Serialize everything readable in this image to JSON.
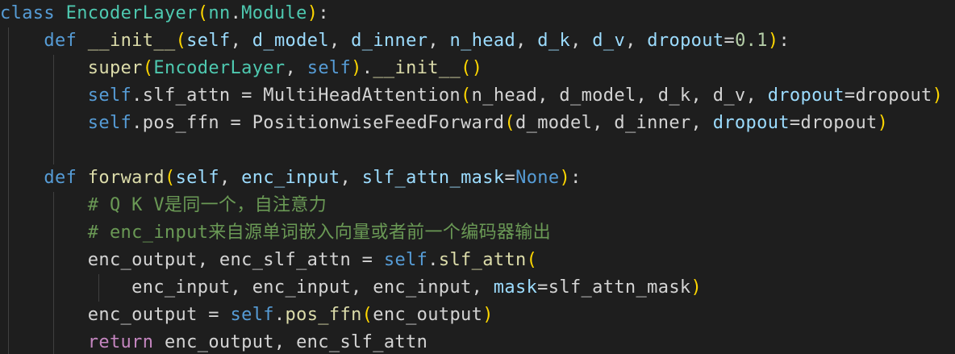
{
  "colors": {
    "background": "#1e1e1e",
    "indent_guide": "#404040",
    "kw": "#569cd6",
    "ctl": "#c586c0",
    "cls": "#4ec9b0",
    "fn": "#dcdcaa",
    "var": "#9cdcfe",
    "num": "#b5cea8",
    "cmt": "#6a9955",
    "txt": "#d4d4d4",
    "p1": "#ffd700",
    "p2": "#da70d6"
  },
  "code_lines": [
    [
      [
        "kw",
        "class"
      ],
      [
        "txt",
        " "
      ],
      [
        "cls",
        "EncoderLayer"
      ],
      [
        "p1",
        "("
      ],
      [
        "cls",
        "nn"
      ],
      [
        "txt",
        "."
      ],
      [
        "cls",
        "Module"
      ],
      [
        "p1",
        ")"
      ],
      [
        "txt",
        ":"
      ]
    ],
    [
      [
        "txt",
        "    "
      ],
      [
        "kw",
        "def"
      ],
      [
        "txt",
        " "
      ],
      [
        "fn",
        "__init__"
      ],
      [
        "p1",
        "("
      ],
      [
        "var",
        "self"
      ],
      [
        "txt",
        ", "
      ],
      [
        "var",
        "d_model"
      ],
      [
        "txt",
        ", "
      ],
      [
        "var",
        "d_inner"
      ],
      [
        "txt",
        ", "
      ],
      [
        "var",
        "n_head"
      ],
      [
        "txt",
        ", "
      ],
      [
        "var",
        "d_k"
      ],
      [
        "txt",
        ", "
      ],
      [
        "var",
        "d_v"
      ],
      [
        "txt",
        ", "
      ],
      [
        "var",
        "dropout"
      ],
      [
        "txt",
        "="
      ],
      [
        "num",
        "0.1"
      ],
      [
        "p1",
        ")"
      ],
      [
        "txt",
        ":"
      ]
    ],
    [
      [
        "txt",
        "        "
      ],
      [
        "fn",
        "super"
      ],
      [
        "p1",
        "("
      ],
      [
        "cls",
        "EncoderLayer"
      ],
      [
        "txt",
        ", "
      ],
      [
        "kw",
        "self"
      ],
      [
        "p1",
        ")"
      ],
      [
        "txt",
        "."
      ],
      [
        "fn",
        "__init__"
      ],
      [
        "p1",
        "()"
      ]
    ],
    [
      [
        "txt",
        "        "
      ],
      [
        "kw",
        "self"
      ],
      [
        "txt",
        ".slf_attn = MultiHeadAttention"
      ],
      [
        "p1",
        "("
      ],
      [
        "txt",
        "n_head, d_model, d_k, d_v, "
      ],
      [
        "var",
        "dropout"
      ],
      [
        "txt",
        "=dropout"
      ],
      [
        "p1",
        ")"
      ]
    ],
    [
      [
        "txt",
        "        "
      ],
      [
        "kw",
        "self"
      ],
      [
        "txt",
        ".pos_ffn = PositionwiseFeedForward"
      ],
      [
        "p1",
        "("
      ],
      [
        "txt",
        "d_model, d_inner, "
      ],
      [
        "var",
        "dropout"
      ],
      [
        "txt",
        "=dropout"
      ],
      [
        "p1",
        ")"
      ]
    ],
    [],
    [
      [
        "txt",
        "    "
      ],
      [
        "kw",
        "def"
      ],
      [
        "txt",
        " "
      ],
      [
        "fn",
        "forward"
      ],
      [
        "p1",
        "("
      ],
      [
        "var",
        "self"
      ],
      [
        "txt",
        ", "
      ],
      [
        "var",
        "enc_input"
      ],
      [
        "txt",
        ", "
      ],
      [
        "var",
        "slf_attn_mask"
      ],
      [
        "txt",
        "="
      ],
      [
        "kw",
        "None"
      ],
      [
        "p1",
        ")"
      ],
      [
        "txt",
        ":"
      ]
    ],
    [
      [
        "txt",
        "        "
      ],
      [
        "cmt",
        "# Q K V是同一个，自注意力"
      ]
    ],
    [
      [
        "txt",
        "        "
      ],
      [
        "cmt",
        "# enc_input来自源单词嵌入向量或者前一个编码器输出"
      ]
    ],
    [
      [
        "txt",
        "        enc_output, enc_slf_attn = "
      ],
      [
        "kw",
        "self"
      ],
      [
        "txt",
        "."
      ],
      [
        "fn",
        "slf_attn"
      ],
      [
        "p1",
        "("
      ]
    ],
    [
      [
        "txt",
        "            enc_input, enc_input, enc_input, "
      ],
      [
        "var",
        "mask"
      ],
      [
        "txt",
        "=slf_attn_mask"
      ],
      [
        "p1",
        ")"
      ]
    ],
    [
      [
        "txt",
        "        enc_output = "
      ],
      [
        "kw",
        "self"
      ],
      [
        "txt",
        "."
      ],
      [
        "fn",
        "pos_ffn"
      ],
      [
        "p1",
        "("
      ],
      [
        "txt",
        "enc_output"
      ],
      [
        "p1",
        ")"
      ]
    ],
    [
      [
        "txt",
        "        "
      ],
      [
        "ctl",
        "return"
      ],
      [
        "txt",
        " enc_output, enc_slf_attn"
      ]
    ]
  ]
}
